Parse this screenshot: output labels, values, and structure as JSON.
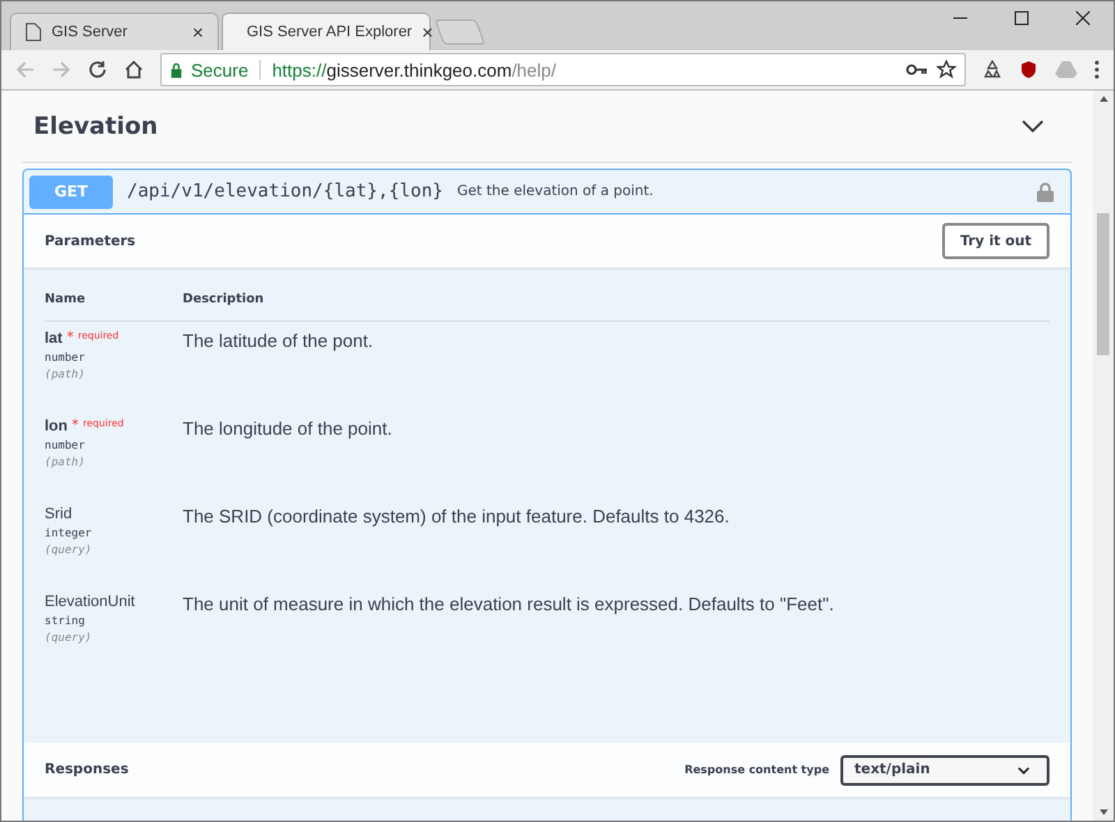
{
  "browser": {
    "tabs": [
      {
        "title": "GIS Server",
        "selected": false,
        "close": "×"
      },
      {
        "title": "GIS Server API Explorer",
        "selected": true,
        "close": "×"
      }
    ],
    "security_label": "Secure",
    "url": {
      "scheme": "https://",
      "host": "gisserver.thinkgeo.com",
      "path": "/help/"
    }
  },
  "section": {
    "title": "Elevation",
    "expanded": true
  },
  "operation": {
    "method": "GET",
    "path": "/api/v1/elevation/{lat},{lon}",
    "summary": "Get the elevation of a point.",
    "locked": true,
    "parameters_title": "Parameters",
    "try_button": "Try it out",
    "columns": [
      "Name",
      "Description"
    ],
    "parameters": [
      {
        "name": "lat",
        "required": true,
        "required_mark": "*",
        "required_label": "required",
        "type": "number",
        "location": "(path)",
        "description": "The latitude of the pont."
      },
      {
        "name": "lon",
        "required": true,
        "required_mark": "*",
        "required_label": "required",
        "type": "number",
        "location": "(path)",
        "description": "The longitude of the point."
      },
      {
        "name": "Srid",
        "required": false,
        "type": "integer",
        "location": "(query)",
        "description": "The SRID (coordinate system) of the input feature. Defaults to 4326."
      },
      {
        "name": "ElevationUnit",
        "required": false,
        "type": "string",
        "location": "(query)",
        "description": "The unit of measure in which the elevation result is expressed. Defaults to \"Feet\"."
      }
    ],
    "responses_title": "Responses",
    "content_type_label": "Response content type",
    "content_type": "text/plain"
  }
}
